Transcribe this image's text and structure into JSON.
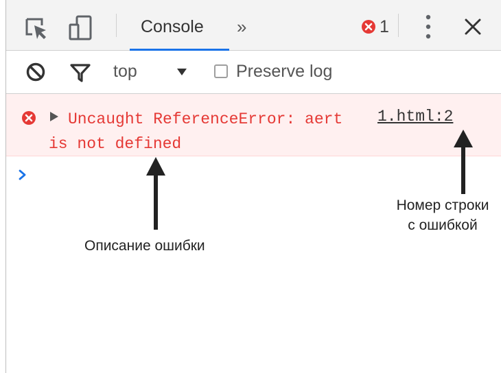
{
  "toolbar": {
    "tab_label": "Console",
    "more_tabs_glyph": "»",
    "error_count": "1",
    "icons": [
      "inspect-element-icon",
      "device-toolbar-icon",
      "error-icon",
      "kebab-menu-icon",
      "close-icon"
    ]
  },
  "filter_bar": {
    "context_value": "top",
    "preserve_log_label": "Preserve log",
    "preserve_log_checked": false,
    "icons": [
      "clear-console-icon",
      "filter-icon",
      "dropdown-arrow-icon"
    ]
  },
  "console": {
    "error_message": "Uncaught ReferenceError: aert is not defined",
    "source_link": "1.html:2",
    "prompt_glyph": "›"
  },
  "annotations": {
    "description_label": "Описание ошибки",
    "line_number_label_1": "Номер строки",
    "line_number_label_2": "с ошибкой"
  },
  "colors": {
    "error_text": "#e53935",
    "error_bg": "#fff0f0",
    "accent": "#1a73e8",
    "error_icon": "#e53935"
  }
}
